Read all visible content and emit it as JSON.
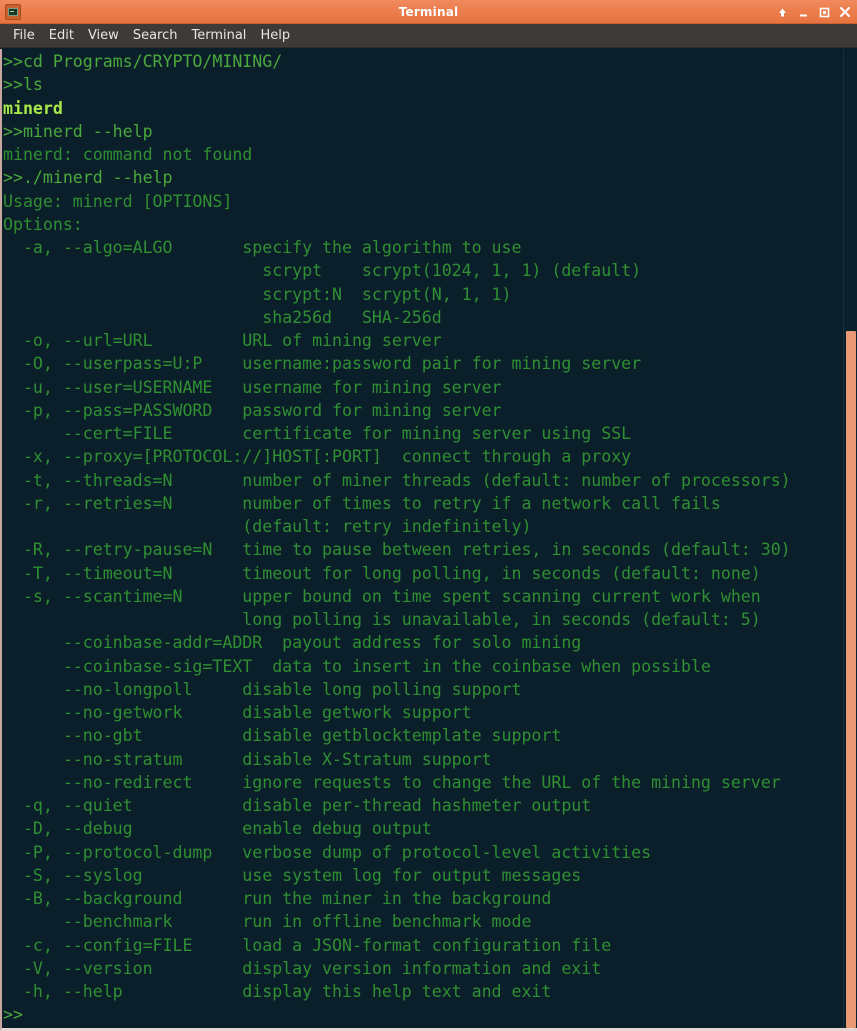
{
  "window": {
    "title": "Terminal",
    "app_icon": "terminal-icon",
    "buttons": [
      {
        "name": "rollup-button",
        "glyph": "↑",
        "label": "Roll up"
      },
      {
        "name": "minimize-button",
        "glyph": "–",
        "label": "Minimize"
      },
      {
        "name": "maximize-button",
        "glyph": "□",
        "label": "Maximize"
      },
      {
        "name": "close-button",
        "glyph": "✕",
        "label": "Close"
      }
    ]
  },
  "menubar": {
    "items": [
      {
        "name": "menu-file",
        "label": "File"
      },
      {
        "name": "menu-edit",
        "label": "Edit"
      },
      {
        "name": "menu-view",
        "label": "View"
      },
      {
        "name": "menu-search",
        "label": "Search"
      },
      {
        "name": "menu-terminal",
        "label": "Terminal"
      },
      {
        "name": "menu-help",
        "label": "Help"
      }
    ]
  },
  "colors": {
    "titlebar": "#ec7d4d",
    "menubar": "#3d3b38",
    "terminal_background": "#0b1f2a",
    "output_text": "#2f8f32",
    "prompt_text": "#4aa83c",
    "file_text": "#a7e84a",
    "scrollbar_thumb": "#e99974",
    "border": "#e8d7d0"
  },
  "terminal": {
    "prompt": ">>",
    "lines": [
      {
        "style": "prompt",
        "text": ">>cd Programs/CRYPTO/MINING/"
      },
      {
        "style": "prompt",
        "text": ">>ls"
      },
      {
        "style": "file",
        "text": "minerd"
      },
      {
        "style": "prompt",
        "text": ">>minerd --help"
      },
      {
        "style": "out",
        "text": "minerd: command not found"
      },
      {
        "style": "prompt",
        "text": ">>./minerd --help"
      },
      {
        "style": "out",
        "text": "Usage: minerd [OPTIONS]"
      },
      {
        "style": "out",
        "text": "Options:"
      },
      {
        "style": "out",
        "text": "  -a, --algo=ALGO       specify the algorithm to use"
      },
      {
        "style": "out",
        "text": "                          scrypt    scrypt(1024, 1, 1) (default)"
      },
      {
        "style": "out",
        "text": "                          scrypt:N  scrypt(N, 1, 1)"
      },
      {
        "style": "out",
        "text": "                          sha256d   SHA-256d"
      },
      {
        "style": "out",
        "text": "  -o, --url=URL         URL of mining server"
      },
      {
        "style": "out",
        "text": "  -O, --userpass=U:P    username:password pair for mining server"
      },
      {
        "style": "out",
        "text": "  -u, --user=USERNAME   username for mining server"
      },
      {
        "style": "out",
        "text": "  -p, --pass=PASSWORD   password for mining server"
      },
      {
        "style": "out",
        "text": "      --cert=FILE       certificate for mining server using SSL"
      },
      {
        "style": "out",
        "text": "  -x, --proxy=[PROTOCOL://]HOST[:PORT]  connect through a proxy"
      },
      {
        "style": "out",
        "text": "  -t, --threads=N       number of miner threads (default: number of processors)"
      },
      {
        "style": "out",
        "text": "  -r, --retries=N       number of times to retry if a network call fails"
      },
      {
        "style": "out",
        "text": "                        (default: retry indefinitely)"
      },
      {
        "style": "out",
        "text": "  -R, --retry-pause=N   time to pause between retries, in seconds (default: 30)"
      },
      {
        "style": "out",
        "text": "  -T, --timeout=N       timeout for long polling, in seconds (default: none)"
      },
      {
        "style": "out",
        "text": "  -s, --scantime=N      upper bound on time spent scanning current work when"
      },
      {
        "style": "out",
        "text": "                        long polling is unavailable, in seconds (default: 5)"
      },
      {
        "style": "out",
        "text": "      --coinbase-addr=ADDR  payout address for solo mining"
      },
      {
        "style": "out",
        "text": "      --coinbase-sig=TEXT  data to insert in the coinbase when possible"
      },
      {
        "style": "out",
        "text": "      --no-longpoll     disable long polling support"
      },
      {
        "style": "out",
        "text": "      --no-getwork      disable getwork support"
      },
      {
        "style": "out",
        "text": "      --no-gbt          disable getblocktemplate support"
      },
      {
        "style": "out",
        "text": "      --no-stratum      disable X-Stratum support"
      },
      {
        "style": "out",
        "text": "      --no-redirect     ignore requests to change the URL of the mining server"
      },
      {
        "style": "out",
        "text": "  -q, --quiet           disable per-thread hashmeter output"
      },
      {
        "style": "out",
        "text": "  -D, --debug           enable debug output"
      },
      {
        "style": "out",
        "text": "  -P, --protocol-dump   verbose dump of protocol-level activities"
      },
      {
        "style": "out",
        "text": "  -S, --syslog          use system log for output messages"
      },
      {
        "style": "out",
        "text": "  -B, --background      run the miner in the background"
      },
      {
        "style": "out",
        "text": "      --benchmark       run in offline benchmark mode"
      },
      {
        "style": "out",
        "text": "  -c, --config=FILE     load a JSON-format configuration file"
      },
      {
        "style": "out",
        "text": "  -V, --version         display version information and exit"
      },
      {
        "style": "out",
        "text": "  -h, --help            display this help text and exit"
      },
      {
        "style": "prompt",
        "text": ">>"
      }
    ]
  }
}
